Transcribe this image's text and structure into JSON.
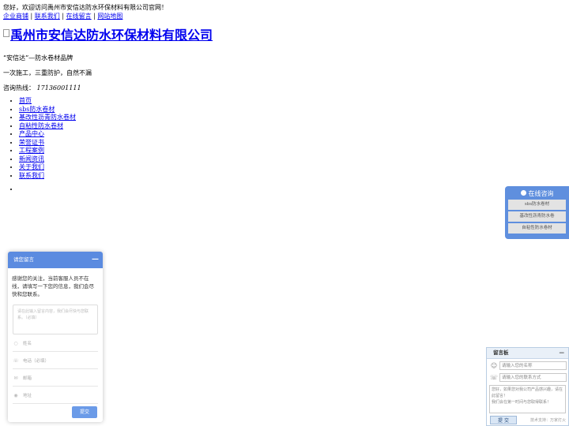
{
  "top": {
    "welcome": "您好，欢迎访问禹州市安信达防水环保材料有限公司官网！",
    "links": [
      "企业商铺",
      "联系我们",
      "在线留言",
      "网站地图"
    ]
  },
  "logo": {
    "text": "禹州市安信达防水环保材料有限公司"
  },
  "slogans": [
    "“安信达”—防水卷材品牌",
    "一次施工，三重防护，自然不漏"
  ],
  "hotline": {
    "label": "咨询热线：",
    "number": "17136001111"
  },
  "nav": [
    "首页",
    "sbs防水卷材",
    "基改性沥青防水卷材",
    "自粘性防水卷材",
    "产品中心",
    "荣誉证书",
    "工程案例",
    "新闻资讯",
    "关于我们",
    "联系我们"
  ],
  "consult": {
    "title": "在线咨询",
    "items": [
      "sbs防水卷材",
      "基改性沥青防水卷",
      "自粘性防水卷材"
    ]
  },
  "message_box": {
    "title": "请您留言",
    "minimize": "—",
    "intro": "感谢您的关注，当前客服人员不在线，请填写一下您的信息，我们会尽快和您联系。",
    "textarea_placeholder": "请在此输入留言内容，我们会尽快与您联系。（必填）",
    "fields": [
      "姓名",
      "电话（必填）",
      "邮箱",
      "地址"
    ],
    "submit": "提交"
  },
  "board": {
    "title": "留言板",
    "minimize": "—",
    "name_placeholder": "请输入您的名称",
    "contact_placeholder": "请输入您的联系方式",
    "content_placeholder": "您好，如果您对我公司产品感兴趣，请在此留言！\n我们会在第一时间与您取得联系！",
    "submit": "提 交",
    "tech": "技术支持：万家灯火"
  }
}
